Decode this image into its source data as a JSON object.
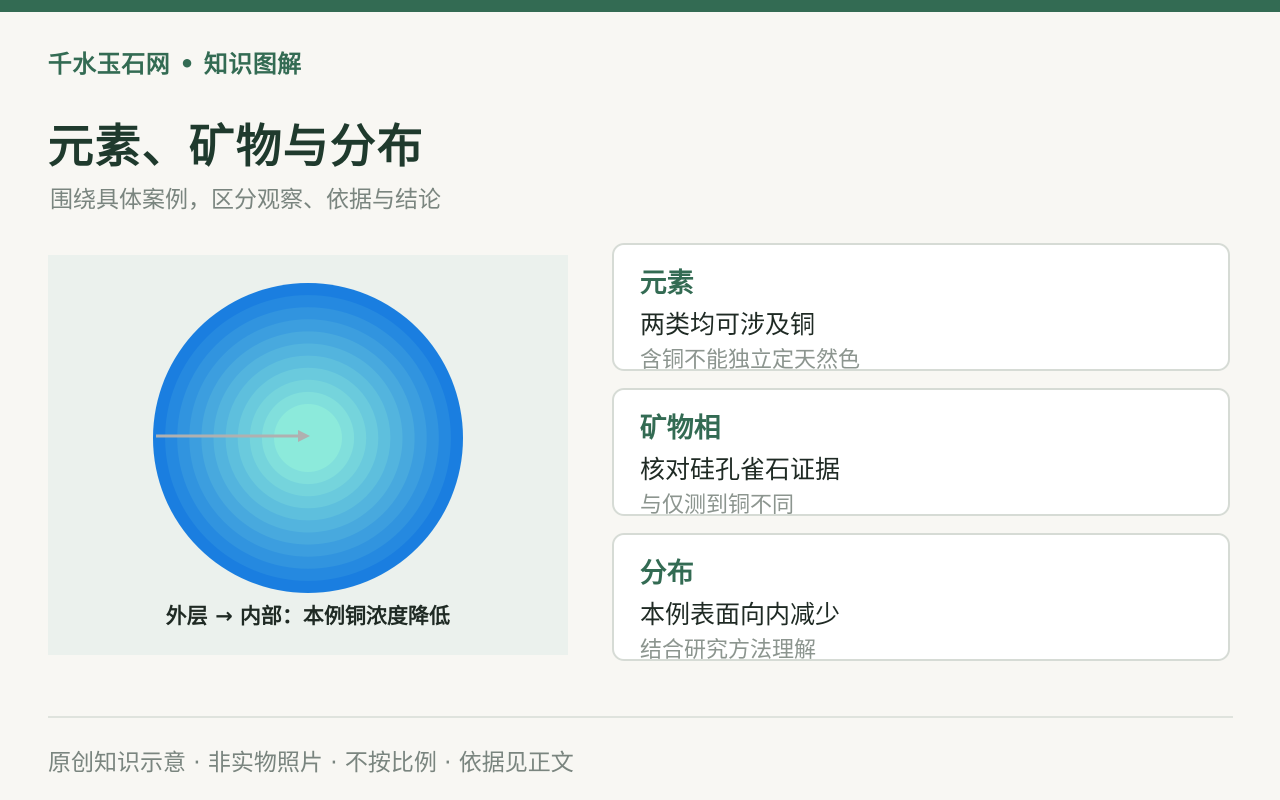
{
  "brand": "千水玉石网 • 知识图解",
  "title": "元素、矿物与分布",
  "subtitle": "围绕具体案例，区分观察、依据与结论",
  "figure": {
    "caption": "外层 → 内部：本例铜浓度降低",
    "colors": {
      "outer": "#1a7ee0",
      "inner": "#8ceadb",
      "arrow": "#b0b0b0",
      "panel": "#ebf1ed"
    }
  },
  "cards": [
    {
      "title": "元素",
      "line": "两类均可涉及铜",
      "note": "含铜不能独立定天然色"
    },
    {
      "title": "矿物相",
      "line": "核对硅孔雀石证据",
      "note": "与仅测到铜不同"
    },
    {
      "title": "分布",
      "line": "本例表面向内减少",
      "note": "结合研究方法理解"
    }
  ],
  "footer": "原创知识示意 · 非实物照片 · 不按比例 · 依据见正文",
  "colors": {
    "accent": "#336b53",
    "title": "#1f3a2d",
    "background": "#f8f7f3"
  }
}
